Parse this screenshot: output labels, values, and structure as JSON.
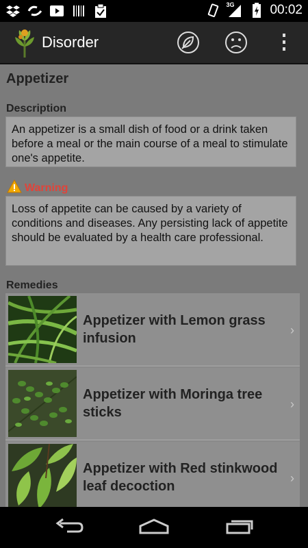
{
  "status_bar": {
    "time": "00:02",
    "network": "3G",
    "left_icons": [
      "dropbox-icon",
      "sync-icon",
      "youtube-icon",
      "barcode-icon",
      "clipboard-check-icon"
    ],
    "right_icons": [
      "vibrate-icon",
      "signal-3g-icon",
      "battery-charging-icon"
    ]
  },
  "action_bar": {
    "title": "Disorder",
    "actions": [
      "leaf-icon",
      "sad-face-icon",
      "overflow-menu-icon"
    ]
  },
  "content": {
    "page_title": "Appetizer",
    "description_label": "Description",
    "description_text": "An appetizer is a small dish of food or a drink taken before a meal or the main course of a meal to stimulate one's appetite.",
    "warning_label": "Warning",
    "warning_text": "Loss of appetite can be caused by a variety of conditions and diseases. Any persisting lack of appetite should be evaluated by a health care professional.",
    "remedies_label": "Remedies",
    "remedies": [
      {
        "title": "Appetizer with Lemon grass infusion",
        "image": "lemon-grass-photo"
      },
      {
        "title": "Appetizer with Moringa tree sticks",
        "image": "moringa-leaves-photo"
      },
      {
        "title": "Appetizer with Red stinkwood leaf decoction",
        "image": "stinkwood-leaves-photo"
      }
    ]
  },
  "nav_bar": {
    "buttons": [
      "back-icon",
      "home-icon",
      "recent-apps-icon"
    ]
  },
  "colors": {
    "content_bg": "#7b7b7b",
    "box_bg": "#a4a4a4",
    "warning_red": "#e0443a",
    "actionbar_bg": "#262626"
  }
}
